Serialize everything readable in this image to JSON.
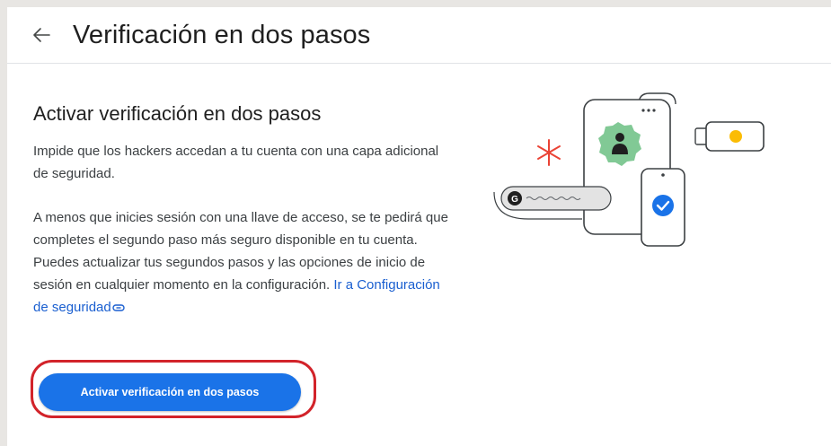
{
  "header": {
    "title": "Verificación en dos pasos"
  },
  "main": {
    "section_title": "Activar verificación en dos pasos",
    "intro_text": "Impide que los hackers accedan a tu cuenta con una capa adicional de seguridad.",
    "description_text": "A menos que inicies sesión con una llave de acceso, se te pedirá que completes el segundo paso más seguro disponible en tu cuenta. Puedes actualizar tus segundos pasos y las opciones de inicio de sesión en cualquier momento en la configuración. ",
    "security_link": "Ir a Configuración de seguridad",
    "activate_button": "Activar verificación en dos pasos"
  },
  "colors": {
    "accent": "#1a73e8",
    "link": "#1a5fd0",
    "highlight": "#d2232a",
    "illustration_green": "#1e8e3e",
    "illustration_badge": "#81c995",
    "illustration_red": "#ea4335",
    "illustration_yellow": "#fbbc04"
  },
  "icons": {
    "back": "arrow-left-icon",
    "link": "link-icon",
    "illustration": "two-step-verification-illustration"
  }
}
